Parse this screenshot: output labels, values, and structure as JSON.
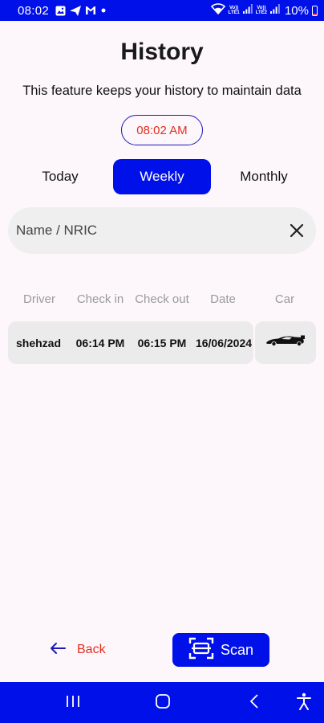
{
  "status_bar": {
    "time": "08:02",
    "net1_label_top": "Vo))",
    "net1_label_bottom": "LTE1",
    "net2_label_top": "Vo))",
    "net2_label_bottom": "LTE2",
    "battery": "10%"
  },
  "page": {
    "title": "History",
    "subtitle": "This feature keeps your history to maintain data",
    "current_time": "08:02 AM"
  },
  "filters": {
    "today": "Today",
    "weekly": "Weekly",
    "monthly": "Monthly",
    "selected": "Weekly",
    "accent_color": "#0010e8"
  },
  "search": {
    "placeholder": "Name / NRIC",
    "value": ""
  },
  "table": {
    "headers": [
      "Driver",
      "Check in",
      "Check out",
      "Date",
      "Car"
    ],
    "rows": [
      {
        "driver": "shehzad",
        "check_in": "06:14 PM",
        "check_out": "06:15 PM",
        "date": "16/06/2024",
        "car_icon": "car-icon"
      }
    ]
  },
  "actions": {
    "back_label": "Back",
    "scan_label": "Scan"
  },
  "colors": {
    "primary": "#0010e8",
    "alert": "#e0301e",
    "background": "#fdf7fc"
  }
}
